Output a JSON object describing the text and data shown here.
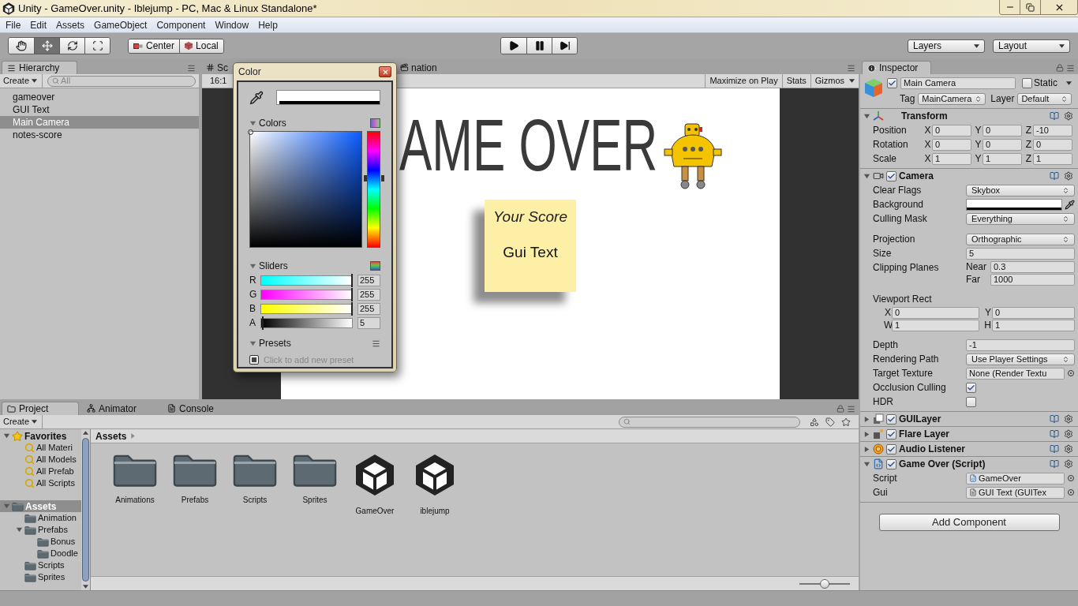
{
  "window": {
    "title": "Unity - GameOver.unity - Iblejump - PC, Mac & Linux Standalone*"
  },
  "menu": [
    "File",
    "Edit",
    "Assets",
    "GameObject",
    "Component",
    "Window",
    "Help"
  ],
  "toolbar": {
    "tools": [
      {
        "kind": "hand",
        "selected": false
      },
      {
        "kind": "move",
        "selected": true
      },
      {
        "kind": "rotate",
        "selected": false
      },
      {
        "kind": "scale",
        "selected": false
      }
    ],
    "pivot": [
      {
        "kind": "pivot",
        "label": "Center"
      },
      {
        "kind": "space",
        "label": "Local"
      }
    ],
    "playback": [
      {
        "kind": "play"
      },
      {
        "kind": "pause"
      },
      {
        "kind": "step"
      }
    ],
    "layers": "Layers",
    "layout": "Layout"
  },
  "hierarchy": {
    "tab": "Hierarchy",
    "create": "Create",
    "search_placeholder": "All",
    "items": [
      {
        "label": "gameover",
        "selected": false
      },
      {
        "label": "GUI Text",
        "selected": false
      },
      {
        "label": "Main Camera",
        "selected": true
      },
      {
        "label": "notes-score",
        "selected": false
      }
    ]
  },
  "scene": {
    "tabs": [
      {
        "kind": "scene",
        "label": "Sc"
      },
      {
        "kind": "animation",
        "label": "nation"
      }
    ],
    "aspect": "16:1",
    "buttons": [
      {
        "label": "Maximize on Play",
        "dropdown": false
      },
      {
        "label": "Stats",
        "dropdown": false
      },
      {
        "label": "Gizmos",
        "dropdown": true
      }
    ],
    "game": {
      "heading": "AME OVER",
      "note": {
        "title": "Your Score",
        "text": "Gui Text"
      }
    }
  },
  "color_picker": {
    "title": "Color",
    "colors_label": "Colors",
    "sliders_label": "Sliders",
    "presets_label": "Presets",
    "hue": {
      "level": 0.6
    },
    "sliders": [
      {
        "channel": "R",
        "value": "255",
        "level": 1
      },
      {
        "channel": "G",
        "value": "255",
        "level": 1
      },
      {
        "channel": "B",
        "value": "255",
        "level": 1
      },
      {
        "channel": "A",
        "value": "5",
        "level": 0.02
      }
    ],
    "preset_hint": "Click to add new preset"
  },
  "inspector": {
    "tab": "Inspector",
    "object": {
      "active": true,
      "name": "Main Camera",
      "static": false,
      "static_label": "Static",
      "tag_label": "Tag",
      "tag": "MainCamera",
      "layer_label": "Layer",
      "layer": "Default"
    },
    "components": [
      {
        "kind": "transform",
        "name": "Transform",
        "expanded": true,
        "fields": [
          {
            "kind": "vector",
            "label": "Position",
            "axes": [
              {
                "axis": "X",
                "value": "0"
              },
              {
                "axis": "Y",
                "value": "0"
              },
              {
                "axis": "Z",
                "value": "-10"
              }
            ]
          },
          {
            "kind": "vector",
            "label": "Rotation",
            "axes": [
              {
                "axis": "X",
                "value": "0"
              },
              {
                "axis": "Y",
                "value": "0"
              },
              {
                "axis": "Z",
                "value": "0"
              }
            ]
          },
          {
            "kind": "vector",
            "label": "Scale",
            "axes": [
              {
                "axis": "X",
                "value": "1"
              },
              {
                "axis": "Y",
                "value": "1"
              },
              {
                "axis": "Z",
                "value": "1"
              }
            ]
          }
        ]
      },
      {
        "kind": "camera",
        "name": "Camera",
        "enabled": true,
        "expanded": true,
        "fields": [
          {
            "kind": "dropdown",
            "label": "Clear Flags",
            "value": "Skybox"
          },
          {
            "kind": "color",
            "label": "Background",
            "color": "#ffffff"
          },
          {
            "kind": "dropdown",
            "label": "Culling Mask",
            "value": "Everything"
          },
          {
            "kind": "dropdown",
            "label": "Projection",
            "value": "Orthographic",
            "gap_before": true
          },
          {
            "kind": "text",
            "label": "Size",
            "value": "5"
          },
          {
            "kind": "pair",
            "label": "Clipping Planes",
            "axes": [
              {
                "axis": "Near",
                "value": "0.3"
              },
              {
                "axis": "Far",
                "value": "1000"
              }
            ]
          },
          {
            "kind": "rect",
            "label": "Viewport Rect",
            "gap_before": true,
            "rows": [
              [
                {
                  "axis": "X",
                  "value": "0"
                },
                {
                  "axis": "Y",
                  "value": "0"
                }
              ],
              [
                {
                  "axis": "W",
                  "value": "1"
                },
                {
                  "axis": "H",
                  "value": "1"
                }
              ]
            ]
          },
          {
            "kind": "text",
            "label": "Depth",
            "value": "-1",
            "gap_before": true
          },
          {
            "kind": "dropdown",
            "label": "Rendering Path",
            "value": "Use Player Settings"
          },
          {
            "kind": "object",
            "label": "Target Texture",
            "value": "None (Render Textu"
          },
          {
            "kind": "checkbox",
            "label": "Occlusion Culling",
            "checked": true
          },
          {
            "kind": "checkbox",
            "label": "HDR",
            "checked": false
          }
        ]
      },
      {
        "kind": "guilayer",
        "name": "GUILayer",
        "enabled": true,
        "expanded": false
      },
      {
        "kind": "flare",
        "name": "Flare Layer",
        "enabled": true,
        "expanded": false
      },
      {
        "kind": "audio",
        "name": "Audio Listener",
        "enabled": true,
        "expanded": false
      },
      {
        "kind": "script",
        "name": "Game Over (Script)",
        "enabled": true,
        "expanded": true,
        "fields": [
          {
            "kind": "object",
            "label": "Script",
            "value": "GameOver"
          },
          {
            "kind": "object",
            "label": "Gui",
            "value": "GUI Text (GUITex"
          }
        ]
      }
    ],
    "add_button": "Add Component"
  },
  "project": {
    "tabs": [
      {
        "kind": "project",
        "label": "Project",
        "selected": true
      },
      {
        "kind": "animator",
        "label": "Animator",
        "selected": false
      },
      {
        "kind": "console",
        "label": "Console",
        "selected": false
      }
    ],
    "create": "Create",
    "tree": [
      {
        "kind": "favorites",
        "label": "Favorites",
        "selected": false,
        "expanded": true,
        "children": [
          {
            "kind": "search",
            "label": "All Materi",
            "selected": false
          },
          {
            "kind": "search",
            "label": "All Models",
            "selected": false
          },
          {
            "kind": "search",
            "label": "All Prefab",
            "selected": false
          },
          {
            "kind": "search",
            "label": "All Scripts",
            "selected": false
          }
        ]
      },
      {
        "kind": "folder",
        "label": "Assets",
        "selected": true,
        "expanded": true,
        "children": [
          {
            "kind": "folder",
            "label": "Animation",
            "selected": false
          },
          {
            "kind": "folder",
            "label": "Prefabs",
            "selected": false,
            "expanded": true,
            "children": [
              {
                "kind": "folder",
                "label": "Bonus",
                "selected": false
              },
              {
                "kind": "folder",
                "label": "Doodle",
                "selected": false
              }
            ]
          },
          {
            "kind": "folder",
            "label": "Scripts",
            "selected": false
          },
          {
            "kind": "folder",
            "label": "Sprites",
            "selected": false
          }
        ]
      }
    ],
    "breadcrumb": "Assets",
    "items": [
      {
        "kind": "folder",
        "label": "Animations"
      },
      {
        "kind": "folder",
        "label": "Prefabs"
      },
      {
        "kind": "folder",
        "label": "Scripts"
      },
      {
        "kind": "folder",
        "label": "Sprites"
      },
      {
        "kind": "scene",
        "label": "GameOver"
      },
      {
        "kind": "scene",
        "label": "iblejump"
      }
    ],
    "icon_size": {
      "level": 0.5
    }
  }
}
